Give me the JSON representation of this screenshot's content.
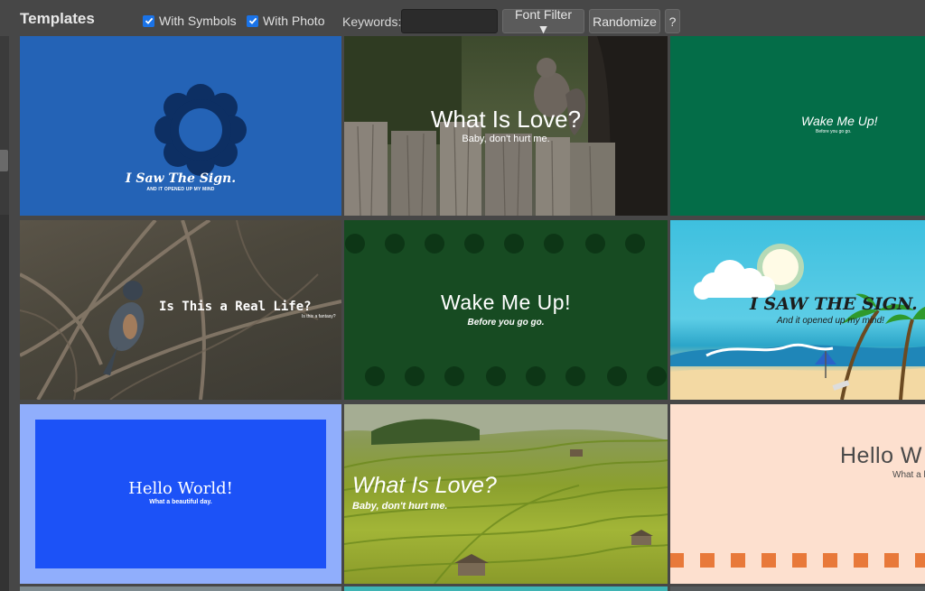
{
  "toolbar": {
    "title": "Templates",
    "with_symbols": {
      "label": "With Symbols",
      "checked": true
    },
    "with_photo": {
      "label": "With Photo",
      "checked": true
    },
    "keywords_label": "Keywords:",
    "keywords_value": "",
    "font_filter_label": "Font Filter ▼",
    "randomize_label": "Randomize",
    "help_label": "?"
  },
  "templates": [
    {
      "title": "I Saw The Sign.",
      "subtitle": "AND IT OPENED UP MY MIND",
      "bg": "#2463b6"
    },
    {
      "title": "What Is Love?",
      "subtitle": "Baby, don't hurt me.",
      "bg": "photo-squirrel-fence"
    },
    {
      "title": "Wake Me Up!",
      "subtitle": "Before you go go.",
      "bg": "#046d48"
    },
    {
      "title": "Is This a Real Life?",
      "subtitle": "Is this a fantasy?",
      "bg": "photo-bird-branches"
    },
    {
      "title": "Wake Me Up!",
      "subtitle": "Before you go go.",
      "bg": "#174b22"
    },
    {
      "title": "I SAW THE SIGN.",
      "subtitle": "And it opened up my mind!",
      "bg": "illustration-beach"
    },
    {
      "title": "Hello World!",
      "subtitle": "What a beautiful day.",
      "bg": "#1c52f7"
    },
    {
      "title": "What Is Love?",
      "subtitle": "Baby, don't hurt me.",
      "bg": "photo-rice-terraces"
    },
    {
      "title": "Hello W",
      "subtitle": "What a b",
      "bg": "#fde0cf"
    }
  ],
  "colors": {
    "accent_checkbox": "#1a73e8",
    "toolbar_bg": "#474747",
    "dot_dark": "#0d3616",
    "square_orange": "#e8793a"
  }
}
